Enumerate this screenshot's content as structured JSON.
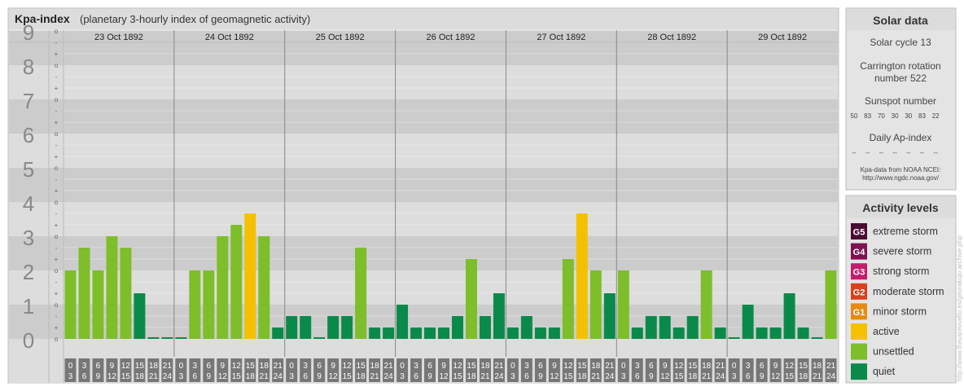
{
  "header": {
    "title": "Kpa-index",
    "subtitle": "(planetary 3-hourly index of geomagnetic activity)"
  },
  "chart_data": {
    "type": "bar",
    "title": "Kpa-index",
    "subtitle": "(planetary 3-hourly index of geomagnetic activity)",
    "ylim": [
      0,
      9
    ],
    "y_ticks": [
      "0",
      "1",
      "2",
      "3",
      "4",
      "5",
      "6",
      "7",
      "8",
      "9"
    ],
    "minor_ticks": [
      "o",
      "+",
      "-"
    ],
    "days": [
      "23 Oct 1892",
      "24 Oct 1892",
      "25 Oct 1892",
      "26 Oct 1892",
      "27 Oct 1892",
      "28 Oct 1892",
      "29 Oct 1892"
    ],
    "interval_starts": [
      "0",
      "3",
      "6",
      "9",
      "12",
      "15",
      "18",
      "21"
    ],
    "interval_ends": [
      "3",
      "6",
      "9",
      "12",
      "15",
      "18",
      "21",
      "24"
    ],
    "values": [
      [
        2,
        2.667,
        2,
        3,
        2.667,
        1.333,
        0,
        0
      ],
      [
        0,
        2,
        2,
        3,
        3.333,
        3.667,
        3,
        0.333
      ],
      [
        0.667,
        0.667,
        0,
        0.667,
        0.667,
        2.667,
        0.333,
        0.333
      ],
      [
        1,
        0.333,
        0.333,
        0.333,
        0.667,
        2.333,
        0.667,
        1.333
      ],
      [
        0.333,
        0.667,
        0.333,
        0.333,
        2.333,
        3.667,
        2,
        1.333
      ],
      [
        2,
        0.333,
        0.667,
        0.667,
        0.333,
        0.667,
        2,
        0.333
      ],
      [
        0,
        1,
        0.333,
        0.333,
        1.333,
        0.333,
        0,
        2
      ]
    ],
    "legend_placement": "right",
    "colors": {
      "quiet": "#0a8a4a",
      "unsettled": "#7dbe2a",
      "active": "#f5c000",
      "minor_storm": "#e88a10",
      "moderate_storm": "#d9401b",
      "strong_storm": "#c41d6c",
      "severe_storm": "#7d1350",
      "extreme_storm": "#4b0c32",
      "band_dark": "#cccccc",
      "band_light": "#dddddd",
      "tick_label": "#888888"
    }
  },
  "solar": {
    "title": "Solar data",
    "cycle": "Solar cycle 13",
    "carrington_line1": "Carrington rotation",
    "carrington_line2": "number 522",
    "sunspot_title": "Sunspot number",
    "sunspots": [
      "50",
      "83",
      "70",
      "30",
      "30",
      "83",
      "22"
    ],
    "ap_title": "Daily Ap-index",
    "ap_values": [
      "--",
      "--",
      "--",
      "--",
      "--",
      "--",
      "--"
    ],
    "source_line1": "Kpa-data from NOAA NCEI:",
    "source_line2": "http://www.ngdc.noaa.gov/"
  },
  "legend": {
    "title": "Activity levels",
    "items": [
      {
        "badge": "G5",
        "label": "extreme storm",
        "color": "#4b0c32"
      },
      {
        "badge": "G4",
        "label": "severe storm",
        "color": "#7d1350"
      },
      {
        "badge": "G3",
        "label": "strong storm",
        "color": "#c41d6c"
      },
      {
        "badge": "G2",
        "label": "moderate storm",
        "color": "#d9401b"
      },
      {
        "badge": "G1",
        "label": "minor storm",
        "color": "#e88a10"
      },
      {
        "badge": "",
        "label": "active",
        "color": "#f5c000"
      },
      {
        "badge": "",
        "label": "unsettled",
        "color": "#7dbe2a"
      },
      {
        "badge": "",
        "label": "quiet",
        "color": "#0a8a4a"
      }
    ]
  },
  "credit": "http://www.theusrevuelto.es/georakujo archive.php"
}
